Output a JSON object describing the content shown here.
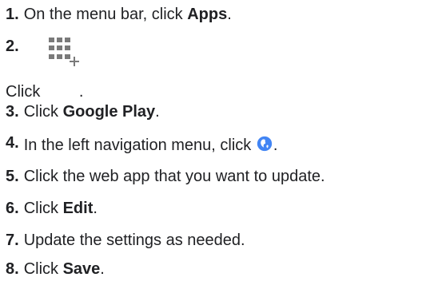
{
  "steps": [
    {
      "number": "1.",
      "before": "On the menu bar, click ",
      "bold": "Apps",
      "after": "."
    },
    {
      "number": "2.",
      "before": "Click ",
      "icon": "apps-plus-icon",
      "after": "."
    },
    {
      "number": "3.",
      "before": "Click ",
      "bold": "Google Play",
      "after": "."
    },
    {
      "number": "4.",
      "before": "In the left navigation menu, click ",
      "icon": "globe-icon",
      "after": "."
    },
    {
      "number": "5.",
      "text": "Click the web app that you want to update."
    },
    {
      "number": "6.",
      "before": "Click ",
      "bold": "Edit",
      "after": "."
    },
    {
      "number": "7.",
      "text": "Update the settings as needed."
    },
    {
      "number": "8.",
      "before": "Click ",
      "bold": "Save",
      "after": "."
    }
  ],
  "colors": {
    "text": "#202124",
    "icon_gray": "#7a7a7a",
    "globe_blue": "#4285f4"
  }
}
